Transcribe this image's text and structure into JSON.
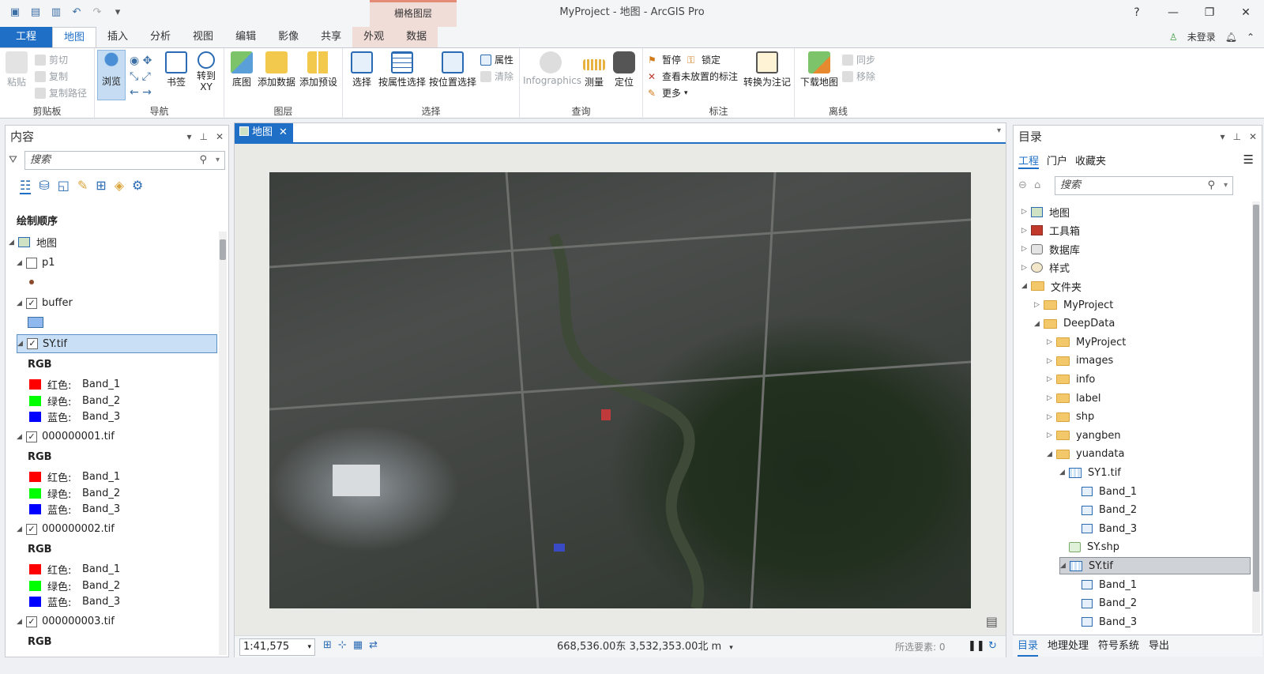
{
  "window": {
    "title": "MyProject - 地图 - ArcGIS Pro",
    "context_header": "栅格图层",
    "controls": [
      "?",
      "—",
      "❐",
      "✕"
    ]
  },
  "tabs": [
    "工程",
    "地图",
    "插入",
    "分析",
    "视图",
    "编辑",
    "影像",
    "共享",
    "外观",
    "数据"
  ],
  "user": {
    "label": "未登录"
  },
  "ribbon": {
    "clipboard": {
      "paste": "粘贴",
      "cut": "剪切",
      "copy": "复制",
      "copy_path": "复制路径",
      "label": "剪贴板"
    },
    "navigate": {
      "explore": "浏览",
      "bookmarks": "书签",
      "goto": "转到\nXY",
      "label": "导航"
    },
    "layer": {
      "basemap": "底图",
      "add_data": "添加数据",
      "add_preset": "添加预设",
      "label": "图层"
    },
    "selection": {
      "select": "选择",
      "by_attr": "按属性选择",
      "by_loc": "按位置选择",
      "attributes": "属性",
      "clear": "清除",
      "label": "选择"
    },
    "inquiry": {
      "infographics": "Infographics",
      "measure": "测量",
      "locate": "定位",
      "label": "查询"
    },
    "labeling": {
      "pause": "暂停",
      "lock": "锁定",
      "view_unplaced": "查看未放置的标注",
      "more": "更多",
      "convert": "转换为注记",
      "label": "标注"
    },
    "offline": {
      "download": "下载地图",
      "sync": "同步",
      "remove": "移除",
      "label": "离线"
    }
  },
  "contents": {
    "title": "内容",
    "search_placeholder": "搜索",
    "draw_order": "绘制顺序",
    "map": "地图",
    "layers": [
      {
        "name": "p1"
      },
      {
        "name": "buffer"
      },
      {
        "name": "SY.tif"
      },
      {
        "name": "000000001.tif"
      },
      {
        "name": "000000002.tif"
      },
      {
        "name": "000000003.tif"
      }
    ],
    "rgb": "RGB",
    "red": "红色:",
    "green": "绿色:",
    "blue": "蓝色:",
    "band1": "Band_1",
    "band2": "Band_2",
    "band3": "Band_3"
  },
  "mapview": {
    "tab": "地图",
    "scale": "1:41,575",
    "coords": "668,536.00东 3,532,353.00北 m",
    "selected": "所选要素: 0"
  },
  "catalog": {
    "title": "目录",
    "tabs": [
      "工程",
      "门户",
      "收藏夹"
    ],
    "search_placeholder": "搜索",
    "items": [
      {
        "label": "地图",
        "indent": 0,
        "kind": "map"
      },
      {
        "label": "工具箱",
        "indent": 0,
        "kind": "toolbox"
      },
      {
        "label": "数据库",
        "indent": 0,
        "kind": "db"
      },
      {
        "label": "样式",
        "indent": 0,
        "kind": "style"
      },
      {
        "label": "文件夹",
        "indent": 0,
        "kind": "folder",
        "open": true
      },
      {
        "label": "MyProject",
        "indent": 1,
        "kind": "folder"
      },
      {
        "label": "DeepData",
        "indent": 1,
        "kind": "folder",
        "open": true
      },
      {
        "label": "MyProject",
        "indent": 2,
        "kind": "folder"
      },
      {
        "label": "images",
        "indent": 2,
        "kind": "folder"
      },
      {
        "label": "info",
        "indent": 2,
        "kind": "folder"
      },
      {
        "label": "label",
        "indent": 2,
        "kind": "folder"
      },
      {
        "label": "shp",
        "indent": 2,
        "kind": "folder"
      },
      {
        "label": "yangben",
        "indent": 2,
        "kind": "folder"
      },
      {
        "label": "yuandata",
        "indent": 2,
        "kind": "folder",
        "open": true
      },
      {
        "label": "SY1.tif",
        "indent": 3,
        "kind": "raster",
        "open": true
      },
      {
        "label": "Band_1",
        "indent": 4,
        "kind": "band"
      },
      {
        "label": "Band_2",
        "indent": 4,
        "kind": "band"
      },
      {
        "label": "Band_3",
        "indent": 4,
        "kind": "band"
      },
      {
        "label": "SY.shp",
        "indent": 3,
        "kind": "shp"
      },
      {
        "label": "SY.tif",
        "indent": 3,
        "kind": "raster",
        "open": true,
        "selected": true
      },
      {
        "label": "Band_1",
        "indent": 4,
        "kind": "band"
      },
      {
        "label": "Band_2",
        "indent": 4,
        "kind": "band"
      },
      {
        "label": "Band_3",
        "indent": 4,
        "kind": "band"
      }
    ],
    "bottom_tabs": [
      "目录",
      "地理处理",
      "符号系统",
      "导出"
    ]
  },
  "colors": {
    "accent": "#1f6fc7",
    "red": "#ff0000",
    "green": "#00ff00",
    "blue": "#0000ff",
    "buffer": "#8fb8ef"
  }
}
